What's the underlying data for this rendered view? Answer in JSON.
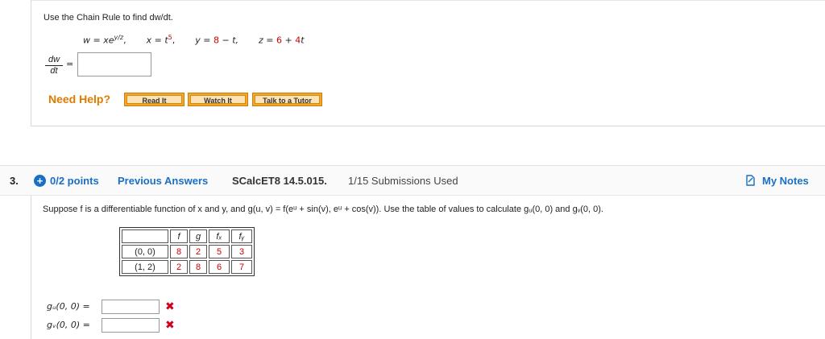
{
  "q2": {
    "instruction": "Use the Chain Rule to find dw/dt.",
    "equation_w": "w = xe",
    "equation_w_exp": "y/z",
    "equation_x": "x = t",
    "equation_x_exp": "5",
    "equation_y_pre": "y = ",
    "equation_y_8": "8",
    "equation_y_post": " − t,",
    "equation_z_pre": "z = ",
    "equation_z_6": "6",
    "equation_z_mid": " + ",
    "equation_z_4": "4",
    "equation_z_t": "t",
    "frac_num": "dw",
    "frac_den": "dt",
    "eq_sign": "=",
    "answer_value": "",
    "need_help": "Need Help?",
    "buttons": [
      "Read It",
      "Watch It",
      "Talk to a Tutor"
    ]
  },
  "q3": {
    "number": "3.",
    "points": "0/2 points",
    "previous_answers": "Previous Answers",
    "code": "SCalcET8 14.5.015.",
    "submissions": "1/15 Submissions Used",
    "my_notes": "My Notes",
    "prompt": "Suppose f is a differentiable function of x and y, and g(u, v) = f(eᵘ + sin(v), eᵘ + cos(v)). Use the table of values to calculate gᵤ(0, 0) and gᵥ(0, 0).",
    "table": {
      "headers": [
        "",
        "f",
        "g",
        "fₓ",
        "fᵧ"
      ],
      "rows": [
        {
          "label": "(0, 0)",
          "values": [
            "8",
            "2",
            "5",
            "3"
          ]
        },
        {
          "label": "(1, 2)",
          "values": [
            "2",
            "8",
            "6",
            "7"
          ]
        }
      ]
    },
    "answers": [
      {
        "label": "gᵤ(0, 0) =",
        "value": "",
        "status": "incorrect"
      },
      {
        "label": "gᵥ(0, 0) =",
        "value": "",
        "status": "incorrect"
      }
    ]
  },
  "colors": {
    "accent": "#1a6fc4",
    "help_orange": "#e07b00",
    "error_red": "#d0021b"
  },
  "icons": {
    "points": "plus-circle-icon",
    "notes": "notes-icon",
    "incorrect": "x-mark-icon"
  }
}
